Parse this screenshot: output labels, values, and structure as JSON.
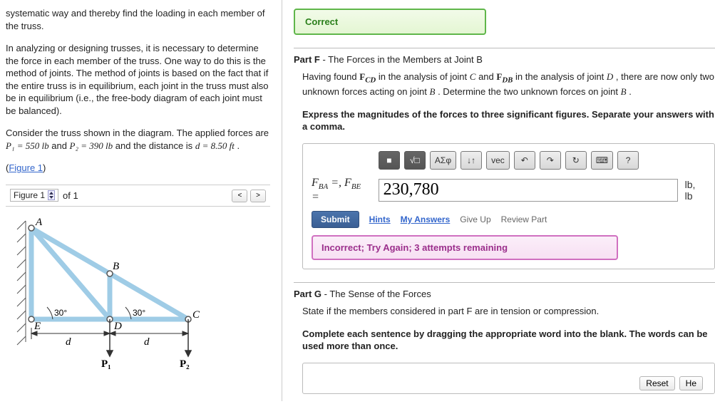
{
  "left": {
    "para1": "systematic way and thereby find the loading in each member of the truss.",
    "para2": "In analyzing or designing trusses, it is necessary to determine the force in each member of the truss. One way to do this is the method of joints. The method of joints is based on the fact that if the entire truss is in equilibrium, each joint in the truss must also be in equilibrium (i.e., the free-body diagram of each joint must be balanced).",
    "para3_pre": "Consider the truss shown in the diagram. The applied forces are ",
    "P1_label": "P₁ = 550 lb",
    "and_word": " and ",
    "P2_label": "P₂ = 390 lb",
    "and_the": " and the distance is ",
    "d_label": "d = 8.50 ft",
    "dot": ".",
    "figure_link": "Figure 1",
    "pager_label": "Figure 1",
    "pager_of": "of 1",
    "nodes": {
      "A": "A",
      "B": "B",
      "C": "C",
      "D": "D",
      "E": "E"
    },
    "ang": "30°",
    "dsym": "d",
    "P1sym": "P₁",
    "P2sym": "P₂"
  },
  "right": {
    "correct_label": "Correct",
    "partF_label": "Part F",
    "partF_title": "The Forces in the Members at Joint B",
    "partF_text_pre": "Having found ",
    "FCD": "F",
    "FCD_sub": "CD",
    "partF_text_mid1": " in the analysis of joint ",
    "C": "C",
    "partF_text_mid2": " and ",
    "FDB": "F",
    "FDB_sub": "DB",
    "partF_text_mid3": " in the analysis of joint ",
    "D": "D",
    "partF_text_mid4": ", there are now only two unknown forces acting on joint ",
    "B": "B",
    "partF_text_mid5": ". Determine the two unknown forces on joint ",
    "partF_text_end": ".",
    "partF_bold": "Express the magnitudes of the forces to three significant figures. Separate your answers with a comma.",
    "toolbar": {
      "template": "■",
      "sqrt": "√□",
      "greek": "ΑΣφ",
      "scripts": "↓↑",
      "vec": "vec",
      "undo": "↶",
      "redo": "↷",
      "reset_in": "↻",
      "keybd": "⌨",
      "help": "?"
    },
    "answer_prefix_a": "F",
    "answer_prefix_a_sub": "BA",
    "answer_eq": " =, ",
    "answer_prefix_b": "F",
    "answer_prefix_b_sub": "BE",
    "answer_eq2": " =",
    "answer_value": "230,780",
    "answer_unit": "lb, lb",
    "submit_label": "Submit",
    "hints_label": "Hints",
    "myanswers_label": "My Answers",
    "giveup_label": "Give Up",
    "review_label": "Review Part",
    "feedback": "Incorrect; Try Again; 3 attempts remaining",
    "partG_label": "Part G",
    "partG_title": "The Sense of the Forces",
    "partG_text": "State if the members considered in part F are in tension or compression.",
    "partG_bold": "Complete each sentence by dragging the appropriate word into the blank. The words can be used more than once.",
    "reset_label": "Reset",
    "help_label": "He"
  }
}
